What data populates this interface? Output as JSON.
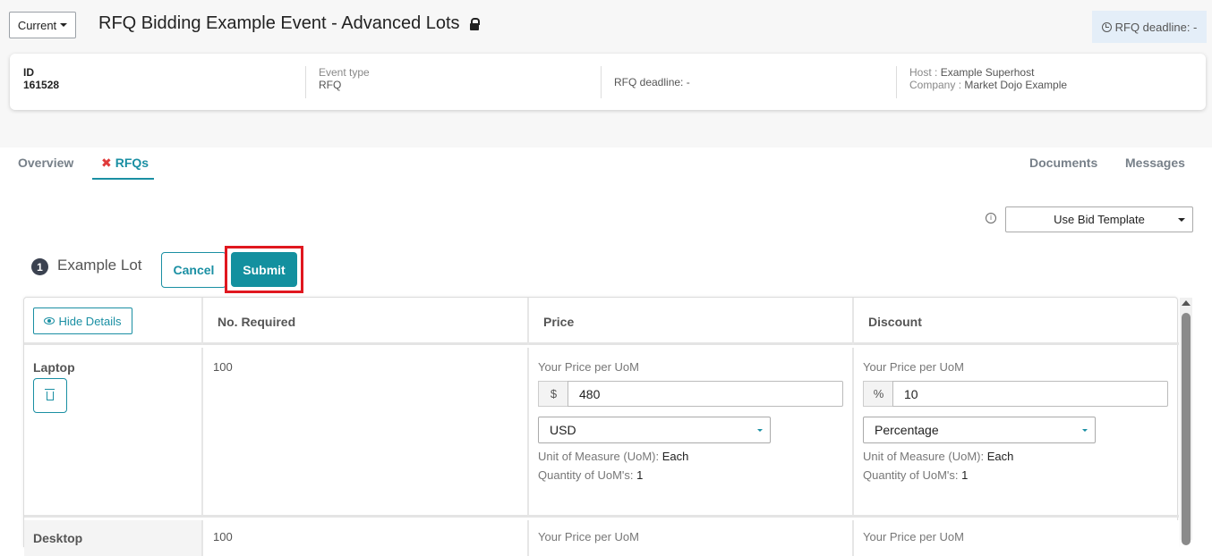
{
  "header": {
    "version_label": "Current",
    "event_title": "RFQ Bidding Example Event - Advanced Lots",
    "deadline_chip": "RFQ deadline: -"
  },
  "info": {
    "id_label": "ID",
    "id_value": "161528",
    "event_type_label": "Event type",
    "event_type_value": "RFQ",
    "deadline": "RFQ deadline: -",
    "host_label": "Host : ",
    "host_value": "Example Superhost",
    "company_label": "Company : ",
    "company_value": "Market Dojo Example"
  },
  "tabs": {
    "overview": "Overview",
    "rfqs": "RFQs",
    "documents": "Documents",
    "messages": "Messages"
  },
  "template": {
    "info_icon": "i",
    "select_value": "Use Bid Template"
  },
  "lot": {
    "number": "1",
    "title": "Example Lot",
    "cancel_label": "Cancel",
    "submit_label": "Submit"
  },
  "table": {
    "hide_details_label": "Hide Details",
    "headers": [
      "No. Required",
      "Price",
      "Discount"
    ],
    "rows": [
      {
        "name": "Laptop",
        "required": "100",
        "price": {
          "label": "Your Price per UoM",
          "addon": "$",
          "value": "480",
          "currency": "USD",
          "uom_label": "Unit of Measure (UoM): ",
          "uom_value": "Each",
          "qty_label": "Quantity of UoM's: ",
          "qty_value": "1"
        },
        "discount": {
          "label": "Your Price per UoM",
          "addon": "%",
          "value": "10",
          "type": "Percentage",
          "uom_label": "Unit of Measure (UoM): ",
          "uom_value": "Each",
          "qty_label": "Quantity of UoM's: ",
          "qty_value": "1"
        }
      },
      {
        "name": "Desktop",
        "required": "100",
        "price_label": "Your Price per UoM",
        "discount_label": "Your Price per UoM"
      }
    ]
  },
  "colors": {
    "accent": "#1a8fa3",
    "submit_bg": "#13909f",
    "highlight": "#e0171f"
  }
}
